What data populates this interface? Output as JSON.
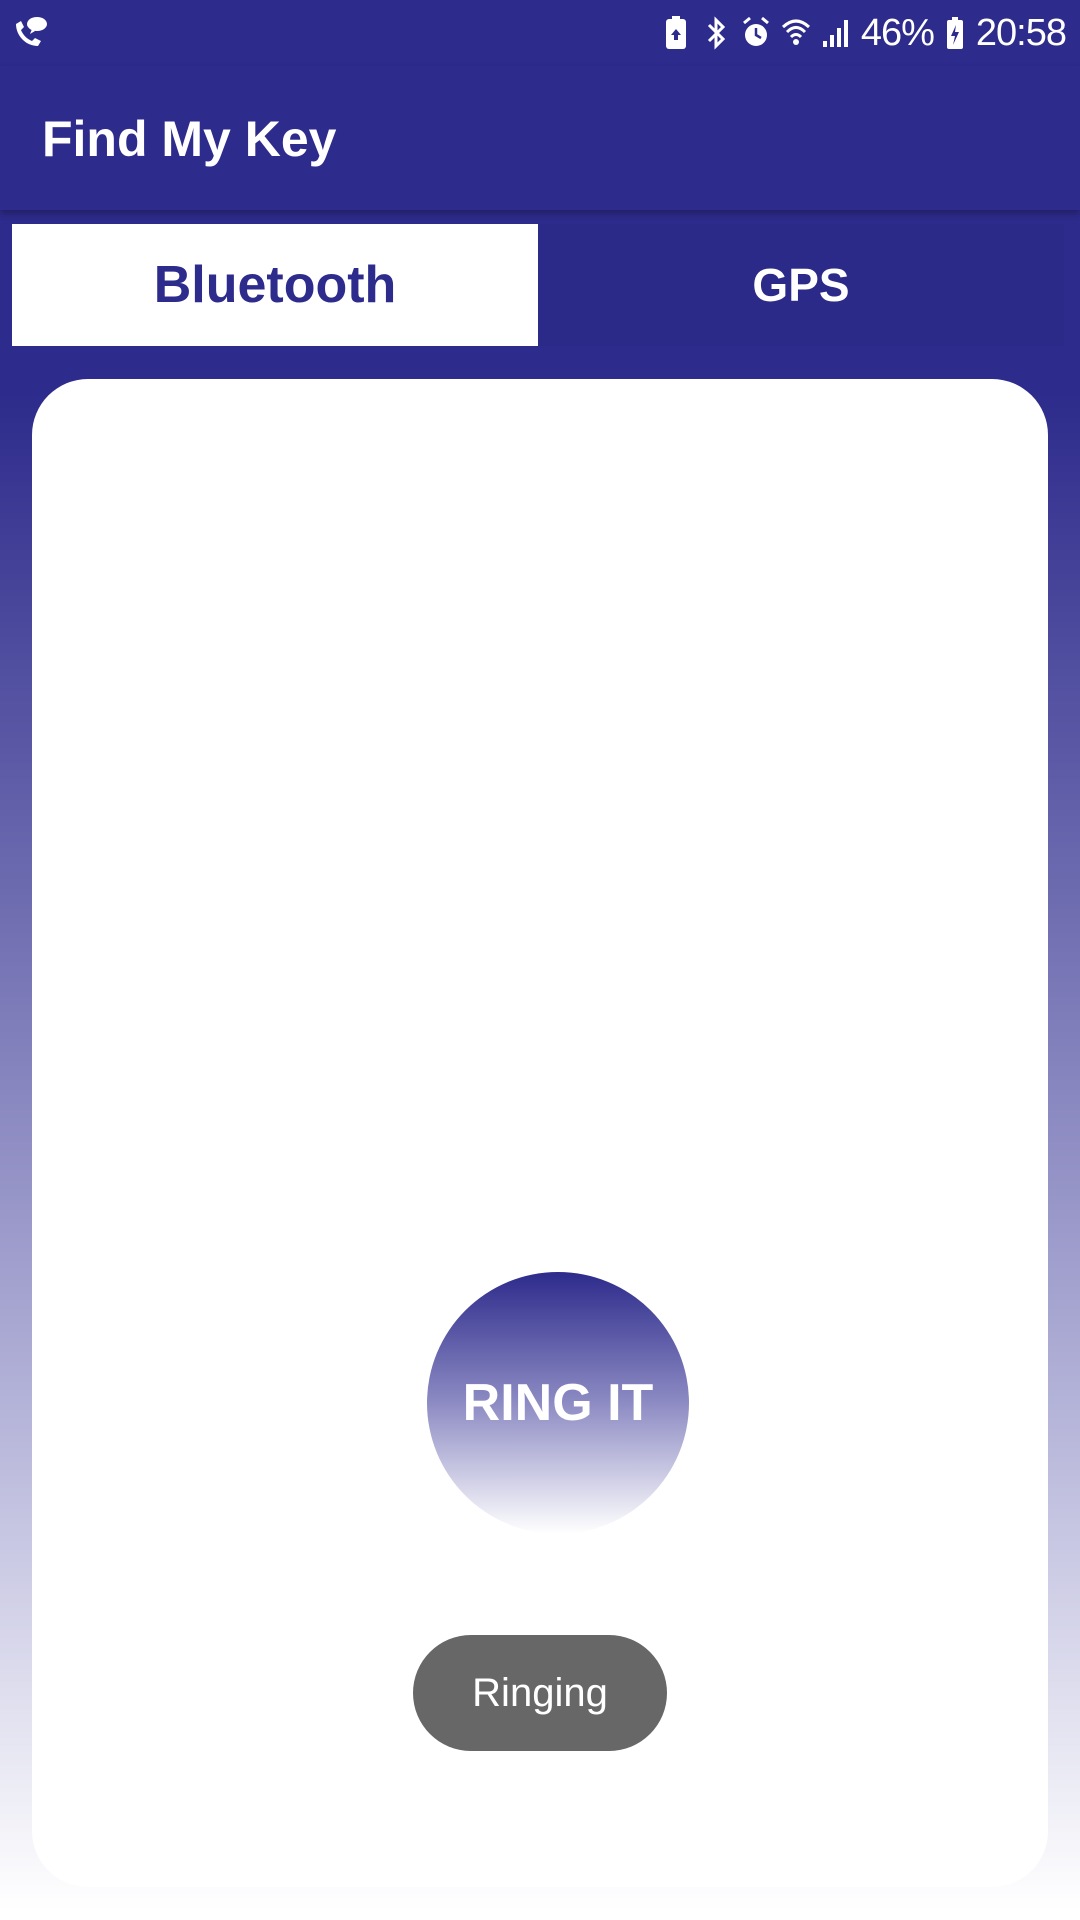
{
  "status_bar": {
    "left_icon": "phone-chat-icon",
    "icons": [
      "battery-saver-icon",
      "bluetooth-icon",
      "alarm-icon",
      "wifi-icon",
      "signal-icon"
    ],
    "battery_percent": "46%",
    "battery_icon": "battery-charging-icon",
    "time": "20:58"
  },
  "app_bar": {
    "title": "Find My Key"
  },
  "tabs": [
    {
      "label": "Bluetooth",
      "selected": true
    },
    {
      "label": "GPS",
      "selected": false
    }
  ],
  "main": {
    "ring_button_label": "RING IT",
    "toast_text": "Ringing"
  },
  "colors": {
    "primary": "#2d2b8b",
    "toast_bg": "#676767",
    "card_bg": "#ffffff"
  }
}
